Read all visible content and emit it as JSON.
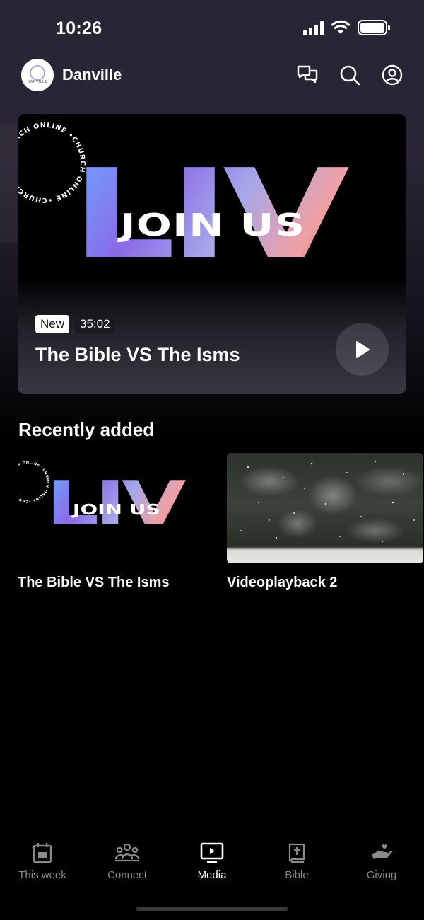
{
  "status_bar": {
    "time": "10:26"
  },
  "header": {
    "church_name": "Danville",
    "icons": [
      "chat-icon",
      "search-icon",
      "profile-icon"
    ]
  },
  "hero": {
    "badge_new": "New",
    "duration": "35:02",
    "title": "The Bible VS The Isms",
    "art_big_word": "LIVE",
    "art_overlay_word": "JOIN US",
    "art_circle_text": "•CHURCH ONLINE •CHURCH ONLINE •CHURCH ONLINE"
  },
  "recently_added": {
    "title": "Recently added",
    "items": [
      {
        "title": "The Bible VS The Isms"
      },
      {
        "title": "Videoplayback 2"
      }
    ]
  },
  "tab_bar": {
    "items": [
      {
        "label": "This week",
        "icon": "calendar-icon",
        "active": false
      },
      {
        "label": "Connect",
        "icon": "group-icon",
        "active": false
      },
      {
        "label": "Media",
        "icon": "play-screen-icon",
        "active": true
      },
      {
        "label": "Bible",
        "icon": "bible-icon",
        "active": false
      },
      {
        "label": "Giving",
        "icon": "giving-hand-icon",
        "active": false
      }
    ]
  },
  "colors": {
    "background": "#000000",
    "header_bg": "#2a2534",
    "tab_inactive": "#8a8a8e",
    "tab_active": "#ffffff"
  }
}
